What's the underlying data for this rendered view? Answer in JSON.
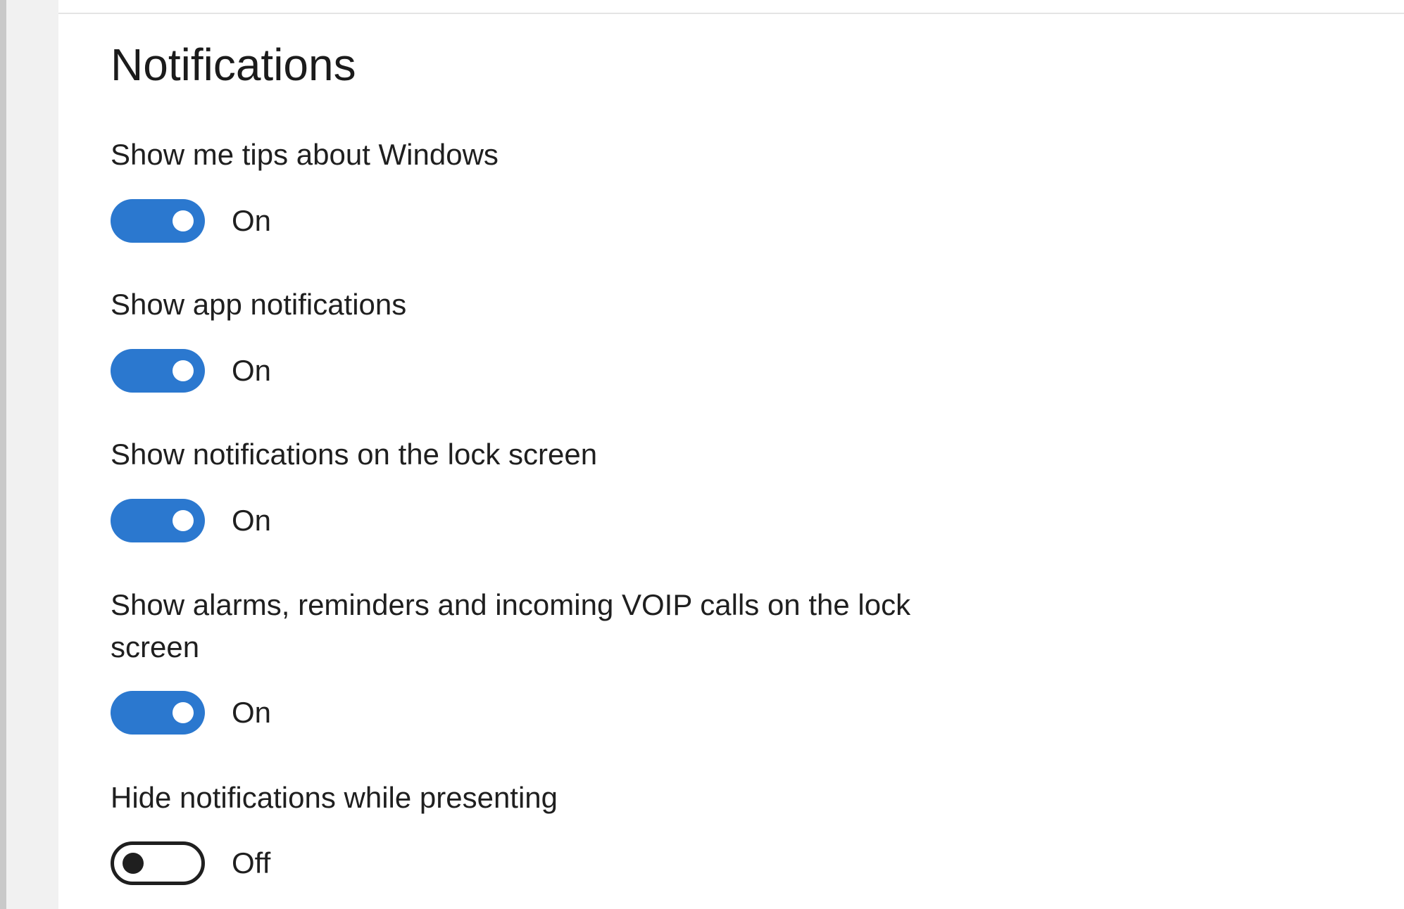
{
  "page": {
    "title": "Notifications"
  },
  "settings": [
    {
      "label": "Show me tips about Windows",
      "state": "On",
      "on": true
    },
    {
      "label": "Show app notifications",
      "state": "On",
      "on": true
    },
    {
      "label": "Show notifications on the lock screen",
      "state": "On",
      "on": true
    },
    {
      "label": "Show alarms, reminders and incoming VOIP calls on the lock screen",
      "state": "On",
      "on": true
    },
    {
      "label": "Hide notifications while presenting",
      "state": "Off",
      "on": false
    }
  ],
  "colors": {
    "accent": "#2b78cf",
    "toggle_off_outline": "#1f1f1f",
    "sidebar": "#f1f1f1"
  }
}
